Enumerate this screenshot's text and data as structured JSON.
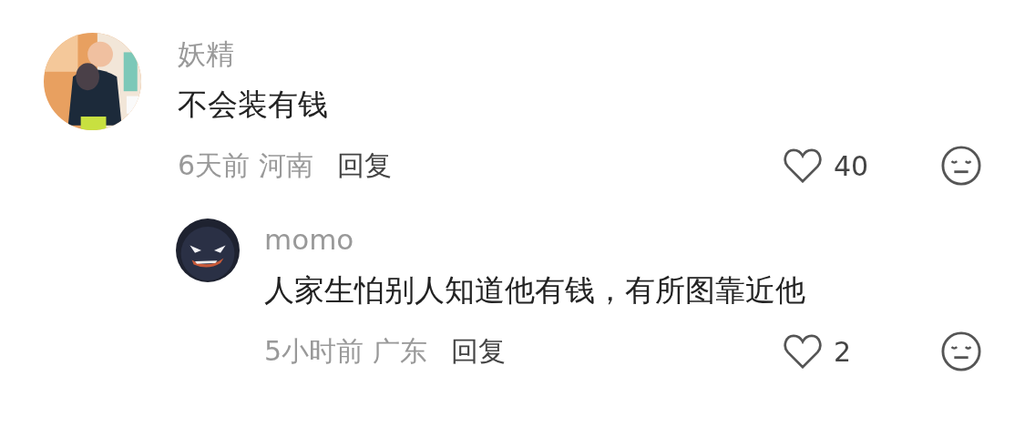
{
  "comments": [
    {
      "kind": "comment",
      "author": "妖精",
      "text": "不会装有钱",
      "time": "6天前",
      "location": "河南",
      "reply_label": "回复",
      "likes": "40"
    },
    {
      "kind": "reply",
      "author": "momo",
      "text": "人家生怕别人知道他有钱，有所图靠近他",
      "time": "5小时前",
      "location": "广东",
      "reply_label": "回复",
      "likes": "2"
    }
  ]
}
